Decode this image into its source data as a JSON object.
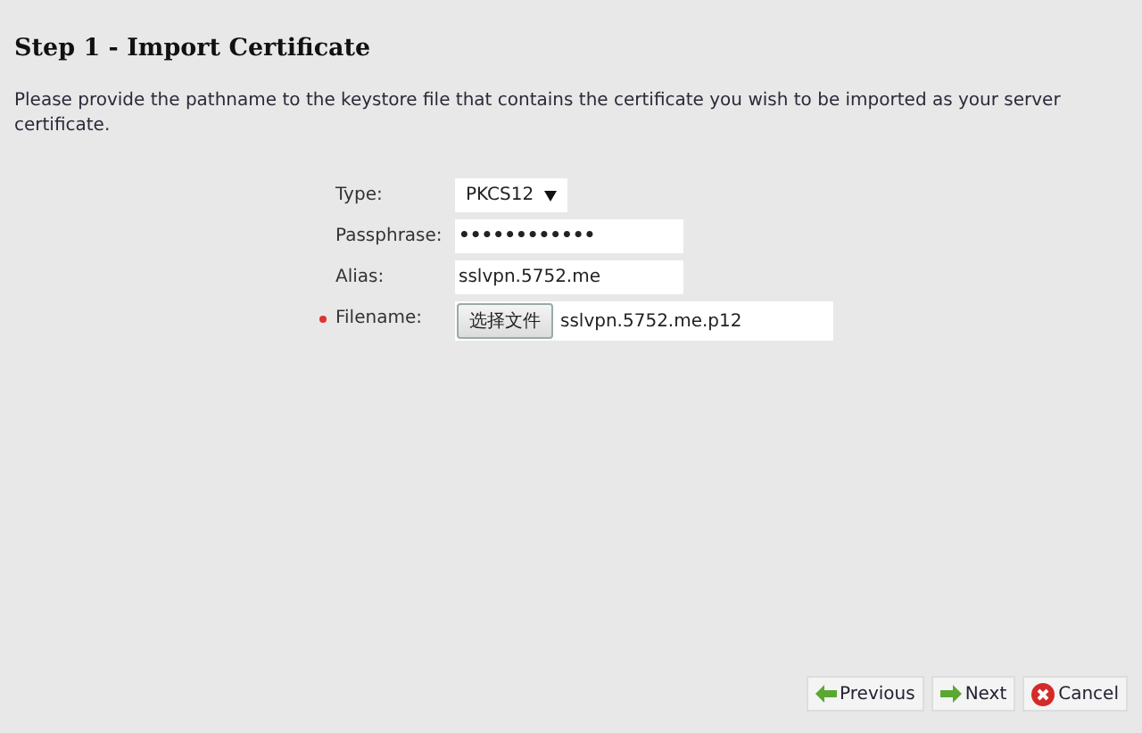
{
  "heading": "Step 1 - Import Certificate",
  "description": "Please provide the pathname to the keystore file that contains the certificate you wish to be imported as your server certificate.",
  "fields": [
    {
      "kind": "select",
      "label": "Type:",
      "value": "PKCS12",
      "required": false
    },
    {
      "kind": "text",
      "label": "Passphrase:",
      "value": "••••••••••••",
      "required": false
    },
    {
      "kind": "text",
      "label": "Alias:",
      "value": "sslvpn.5752.me",
      "required": false
    },
    {
      "kind": "file",
      "label": "Filename:",
      "button": "选择文件",
      "value": "sslvpn.5752.me.p12",
      "required": true
    }
  ],
  "buttons": [
    {
      "kind": "previous",
      "label": "Previous"
    },
    {
      "kind": "next",
      "label": "Next"
    },
    {
      "kind": "cancel",
      "label": "Cancel"
    }
  ]
}
